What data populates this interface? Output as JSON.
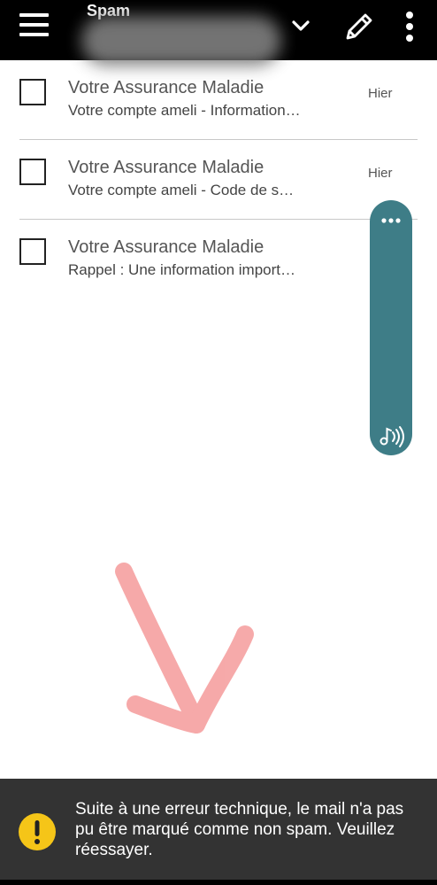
{
  "header": {
    "folder_title": "Spam",
    "menu_icon": "hamburger-menu-icon",
    "dropdown_icon": "chevron-down-icon",
    "compose_icon": "pencil-icon",
    "more_icon": "kebab-menu-icon"
  },
  "messages": [
    {
      "sender": "Votre Assurance Maladie",
      "preview": "Votre compte ameli - Information…",
      "date": "Hier"
    },
    {
      "sender": "Votre Assurance Maladie",
      "preview": "Votre compte ameli - Code de s…",
      "date": "Hier"
    },
    {
      "sender": "Votre Assurance Maladie",
      "preview": "Rappel : Une information import…",
      "date": ""
    }
  ],
  "floating_panel": {
    "more_icon": "horizontal-dots-icon",
    "read_aloud_icon": "music-note-sound-icon",
    "color": "#3e7d87"
  },
  "toast": {
    "message": "Suite à une erreur technique, le mail n'a pas pu être marqué comme non spam. Veuillez réessayer.",
    "icon": "warning-exclamation-icon",
    "icon_color": "#f5c518"
  },
  "annotation": {
    "type": "hand-drawn-arrow",
    "color": "#f6a5a5"
  }
}
